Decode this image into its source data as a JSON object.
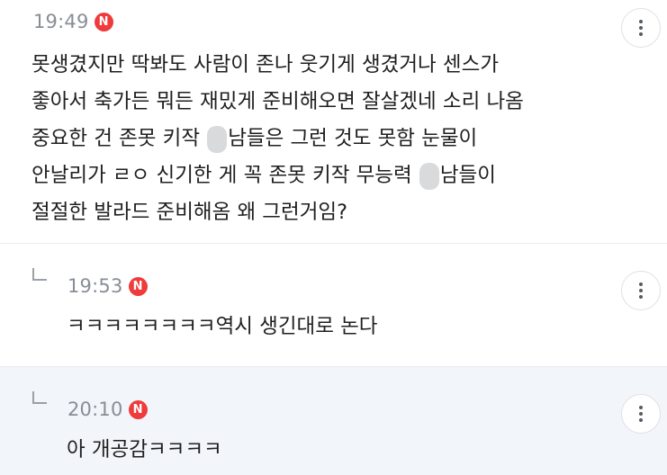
{
  "comments": [
    {
      "time": "19:49",
      "badge": "N",
      "lines": [
        "못생겼지만 딱봐도 사람이 존나 웃기게 생겼거나 센스가",
        "좋아서 축가든 뭐든 재밌게 준비해오면 잘살겠네 소리 나옴",
        "중요한 건 존못 키작",
        "남들은 그런 것도 못함 눈물이",
        "안날리가 ㄹㅇ 신기한 게 꼭 존못 키작 무능력",
        "남들이",
        "절절한 발라드 준비해옴 왜 그런거임?"
      ]
    },
    {
      "time": "19:53",
      "badge": "N",
      "text": "ㅋㅋㅋㅋㅋㅋㅋㅋ역시 생긴대로 논다"
    },
    {
      "time": "20:10",
      "badge": "N",
      "text": "아 개공감ㅋㅋㅋㅋ"
    }
  ],
  "icons": {
    "more": "more-vertical-icon",
    "reply": "reply-arrow-icon",
    "new": "new-badge-icon"
  },
  "colors": {
    "badge": "#ef3b3b",
    "highlight_bg": "#f2f5fa",
    "time": "#888e96"
  }
}
